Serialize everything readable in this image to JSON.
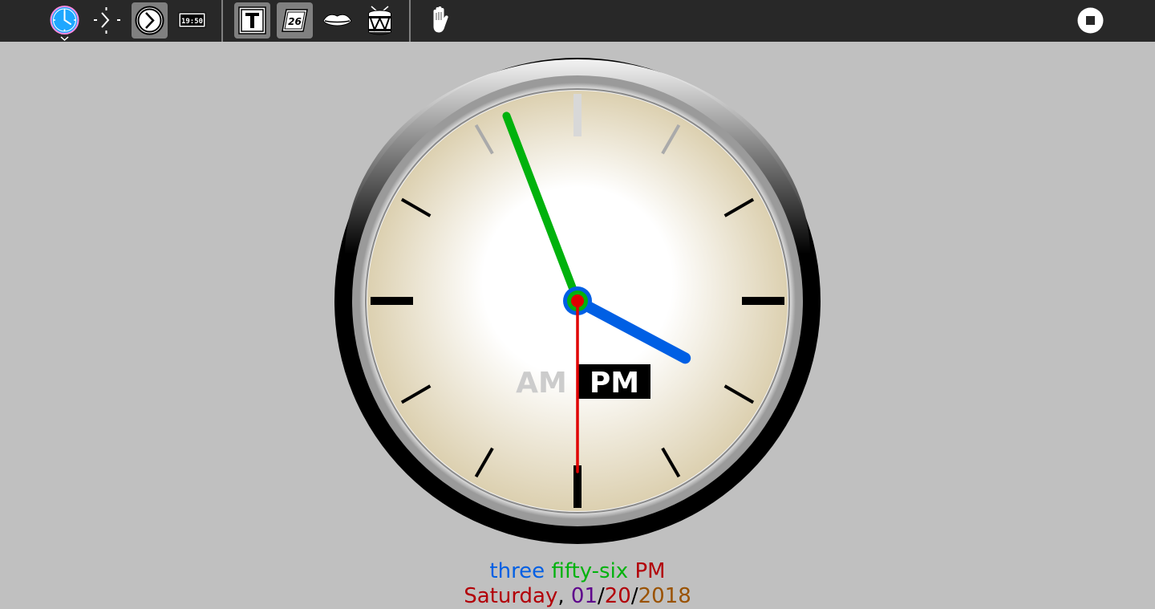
{
  "toolbar": {
    "buttons": [
      {
        "name": "activity-clock-button",
        "icon": "clock-activity-icon"
      },
      {
        "name": "simple-clock-button",
        "icon": "simple-clock-icon"
      },
      {
        "name": "nice-clock-button",
        "icon": "nice-clock-icon",
        "active": true
      },
      {
        "name": "digital-clock-button",
        "icon": "digital-clock-icon",
        "label": "19:50"
      },
      {
        "name": "write-time-button",
        "icon": "text-t-icon"
      },
      {
        "name": "write-date-button",
        "icon": "calendar-icon",
        "label": "26",
        "active": true
      },
      {
        "name": "speak-time-button",
        "icon": "lips-icon"
      },
      {
        "name": "tick-sound-button",
        "icon": "drum-icon"
      },
      {
        "name": "grab-hands-button",
        "icon": "hand-icon"
      },
      {
        "name": "stop-button",
        "icon": "stop-icon"
      }
    ]
  },
  "clock": {
    "hours": 3,
    "minutes": 56,
    "seconds": 30,
    "am_label": "AM",
    "pm_label": "PM",
    "active_period": "PM",
    "colors": {
      "hour_hand": "#005fe4",
      "minute_hand": "#00b20d",
      "second_hand": "#e00000",
      "center": "#e00000",
      "face_light": "#ffffff",
      "face_dark": "#dcd0b0"
    }
  },
  "time_text": {
    "hour_word": "three",
    "minute_word": "fifty-six",
    "period": "PM",
    "hour_color": "#005fe4",
    "minute_color": "#00b20d",
    "period_color": "#b20008"
  },
  "date_text": {
    "weekday": "Saturday",
    "sep1": ", ",
    "month": "01",
    "slash1": "/",
    "day": "20",
    "slash2": "/",
    "year": "2018",
    "weekday_color": "#b20008",
    "month_color": "#5e008c",
    "day_color": "#b20008",
    "year_color": "#9a5200"
  }
}
